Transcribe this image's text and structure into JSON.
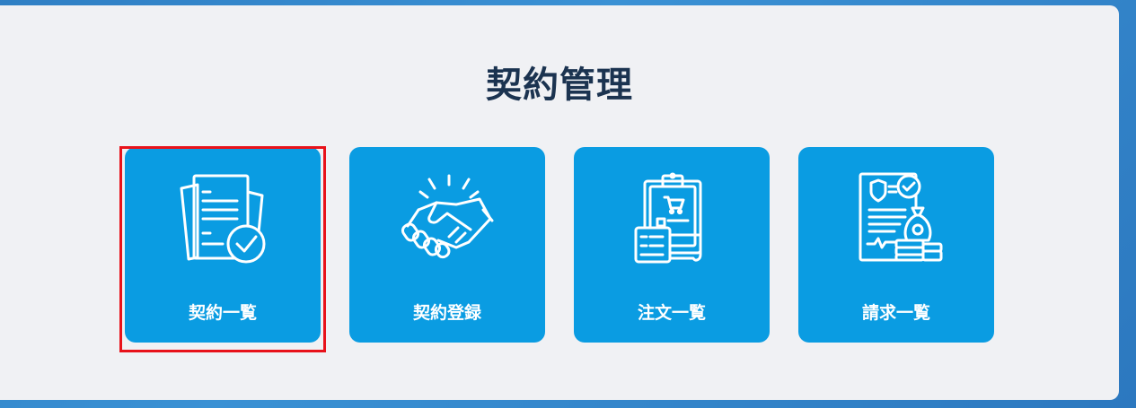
{
  "page": {
    "title": "契約管理"
  },
  "tiles": [
    {
      "label": "契約一覧",
      "icon": "contract-list-icon",
      "selected": true
    },
    {
      "label": "契約登録",
      "icon": "handshake-icon",
      "selected": false
    },
    {
      "label": "注文一覧",
      "icon": "order-clipboard-icon",
      "selected": false
    },
    {
      "label": "請求一覧",
      "icon": "invoice-money-icon",
      "selected": false
    }
  ],
  "colors": {
    "tile": "#0a9ce2",
    "panel": "#f0f1f4",
    "title": "#1b3350",
    "highlight": "#e8121a"
  }
}
